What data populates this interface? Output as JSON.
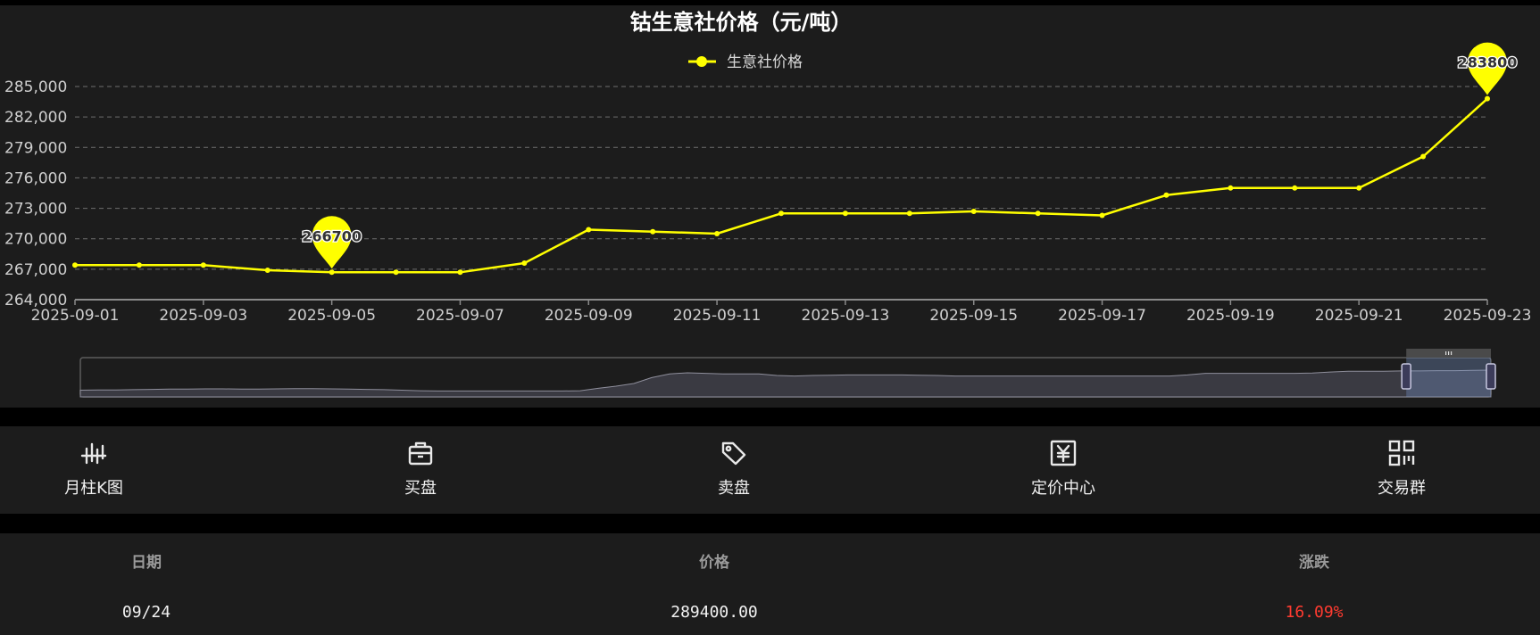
{
  "chart_data": {
    "type": "line",
    "title": "钴生意社价格（元/吨）",
    "legend_position": "top-center",
    "series": [
      {
        "name": "生意社价格",
        "color": "#ffff00",
        "x": [
          "2025-09-01",
          "2025-09-02",
          "2025-09-03",
          "2025-09-04",
          "2025-09-05",
          "2025-09-06",
          "2025-09-07",
          "2025-09-08",
          "2025-09-09",
          "2025-09-10",
          "2025-09-11",
          "2025-09-12",
          "2025-09-13",
          "2025-09-14",
          "2025-09-15",
          "2025-09-16",
          "2025-09-17",
          "2025-09-18",
          "2025-09-19",
          "2025-09-20",
          "2025-09-21",
          "2025-09-22",
          "2025-09-23"
        ],
        "values": [
          267400,
          267400,
          267400,
          266900,
          266700,
          266700,
          266700,
          267600,
          270900,
          270700,
          270500,
          272500,
          272500,
          272500,
          272700,
          272500,
          272300,
          274300,
          275000,
          275000,
          275000,
          278100,
          283800
        ]
      }
    ],
    "x_tick_labels": [
      "2025-09-01",
      "2025-09-03",
      "2025-09-05",
      "2025-09-07",
      "2025-09-09",
      "2025-09-11",
      "2025-09-13",
      "2025-09-15",
      "2025-09-17",
      "2025-09-19",
      "2025-09-21",
      "2025-09-23"
    ],
    "y_ticks": [
      264000,
      267000,
      270000,
      273000,
      276000,
      279000,
      282000,
      285000
    ],
    "y_tick_labels": [
      "264,000",
      "267,000",
      "270,000",
      "273,000",
      "276,000",
      "279,000",
      "282,000",
      "285,000"
    ],
    "ylim": [
      264000,
      285000
    ],
    "grid": true,
    "mark_points": [
      {
        "label": "266700",
        "date": "2025-09-05",
        "value": 266700
      },
      {
        "label": "283800",
        "date": "2025-09-23",
        "value": 283800
      }
    ],
    "zoom_window": [
      0.94,
      1.0
    ],
    "overview_values": [
      0.05,
      0.06,
      0.06,
      0.07,
      0.08,
      0.09,
      0.09,
      0.1,
      0.1,
      0.09,
      0.09,
      0.1,
      0.11,
      0.11,
      0.1,
      0.09,
      0.08,
      0.07,
      0.05,
      0.03,
      0.02,
      0.02,
      0.02,
      0.02,
      0.02,
      0.02,
      0.02,
      0.02,
      0.03,
      0.12,
      0.2,
      0.3,
      0.52,
      0.66,
      0.7,
      0.68,
      0.66,
      0.66,
      0.66,
      0.6,
      0.58,
      0.6,
      0.61,
      0.62,
      0.62,
      0.62,
      0.62,
      0.61,
      0.6,
      0.58,
      0.58,
      0.58,
      0.58,
      0.58,
      0.58,
      0.58,
      0.58,
      0.58,
      0.58,
      0.58,
      0.58,
      0.58,
      0.62,
      0.68,
      0.68,
      0.68,
      0.68,
      0.68,
      0.68,
      0.69,
      0.73,
      0.76,
      0.76,
      0.76,
      0.77,
      0.77,
      0.78,
      0.78,
      0.79,
      0.8
    ]
  },
  "toolbar": [
    {
      "label": "月柱K图",
      "icon": "candlestick-icon"
    },
    {
      "label": "买盘",
      "icon": "shopping-bag-icon"
    },
    {
      "label": "卖盘",
      "icon": "tag-icon"
    },
    {
      "label": "定价中心",
      "icon": "yen-icon"
    },
    {
      "label": "交易群",
      "icon": "qr-grid-icon"
    }
  ],
  "table": {
    "headers": [
      "日期",
      "价格",
      "涨跌"
    ],
    "rows": [
      {
        "date": "09/24",
        "price": "289400.00",
        "change": "16.09%"
      }
    ]
  }
}
